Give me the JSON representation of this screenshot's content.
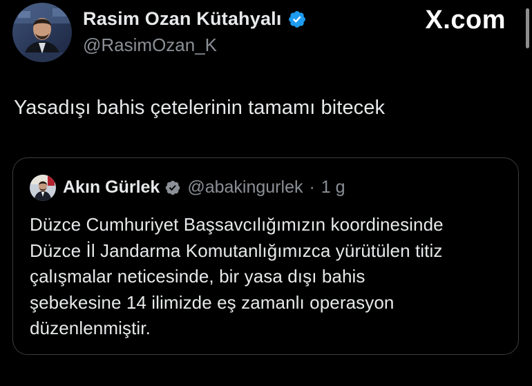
{
  "brand": {
    "label": "X.com"
  },
  "author": {
    "name": "Rasim Ozan Kütahyalı",
    "handle": "@RasimOzan_K",
    "verified": true
  },
  "tweet": {
    "text": "Yasadışı bahis çetelerinin tamamı bitecek"
  },
  "quoted_tweet": {
    "author_name": "Akın Gürlek",
    "handle": "@abakingurlek",
    "separator": "·",
    "time": "1 g",
    "verified": true,
    "body_lines": [
      "Düzce Cumhuriyet Başsavcılığımızın koordinesinde",
      "Düzce İl Jandarma Komutanlığımızca yürütülen titiz",
      "çalışmalar neticesinde, bir yasa dışı bahis",
      "şebekesine 14 ilimizde eş zamanlı operasyon",
      "düzenlenmiştir."
    ]
  },
  "colors": {
    "background": "#000000",
    "text_primary": "#e7e9ea",
    "text_secondary": "#8b9096",
    "verified_blue": "#1d9bf0",
    "card_border": "#3a3d41"
  },
  "icons": {
    "verified": "verified-badge-icon",
    "avatar": "profile-photo",
    "quoted_avatar": "profile-photo"
  }
}
